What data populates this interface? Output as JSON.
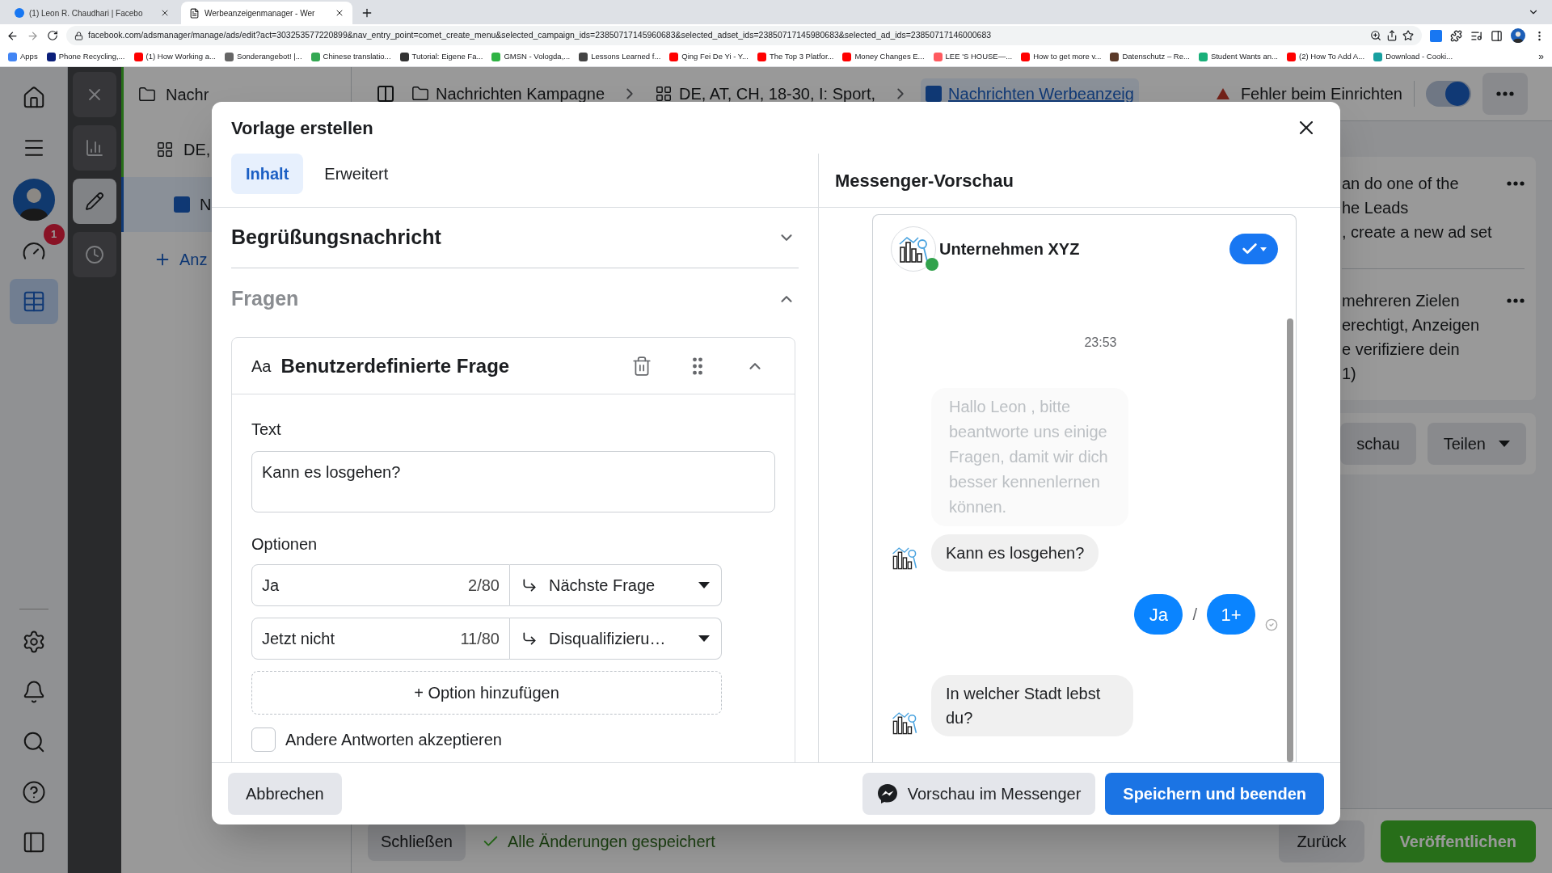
{
  "browser": {
    "tabs": [
      {
        "kind": "facebook",
        "title": "(1) Leon R. Chaudhari | Facebo",
        "selected": false
      },
      {
        "kind": "ads",
        "title": "Werbeanzeigenmanager - Wer",
        "selected": true
      }
    ],
    "url": "facebook.com/adsmanager/manage/ads/edit?act=303253577220899&nav_entry_point=comet_create_menu&selected_campaign_ids=23850717145960683&selected_adset_ids=23850717145980683&selected_ad_ids=23850717146000683",
    "bookmarks": [
      {
        "label": "Apps",
        "color": "#4285f4"
      },
      {
        "label": "Phone Recycling,...",
        "color": "#0b1f7a"
      },
      {
        "label": "(1) How Working a...",
        "color": "#ff0000"
      },
      {
        "label": "Sonderangebot! |...",
        "color": "#666666"
      },
      {
        "label": "Chinese translatio...",
        "color": "#34a853"
      },
      {
        "label": "Tutorial: Eigene Fa...",
        "color": "#333333"
      },
      {
        "label": "GMSN - Vologda,...",
        "color": "#2fb344"
      },
      {
        "label": "Lessons Learned f...",
        "color": "#444444"
      },
      {
        "label": "Qing Fei De Yi - Y...",
        "color": "#ff0000"
      },
      {
        "label": "The Top 3 Platfor...",
        "color": "#ff0000"
      },
      {
        "label": "Money Changes E...",
        "color": "#ff0000"
      },
      {
        "label": "LEE 'S HOUSE—...",
        "color": "#ff5a5f"
      },
      {
        "label": "How to get more v...",
        "color": "#ff0000"
      },
      {
        "label": "Datenschutz – Re...",
        "color": "#5b3a29"
      },
      {
        "label": "Student Wants an...",
        "color": "#1ab07a"
      },
      {
        "label": "(2) How To Add A...",
        "color": "#ff0000"
      },
      {
        "label": "Download - Cooki...",
        "color": "#18a0a0"
      }
    ],
    "more_bookmarks": "»"
  },
  "nav_rail": {
    "items": [
      {
        "kind": "home",
        "selected": false
      },
      {
        "kind": "menu",
        "selected": false
      },
      {
        "kind": "avatar"
      },
      {
        "kind": "gauge",
        "selected": false,
        "badge": "1"
      },
      {
        "kind": "table",
        "selected": true
      }
    ],
    "bottom_items": [
      {
        "kind": "settings",
        "selected": false
      },
      {
        "kind": "bell",
        "selected": false
      },
      {
        "kind": "search",
        "selected": false
      },
      {
        "kind": "help",
        "selected": false
      },
      {
        "kind": "panel",
        "selected": false
      }
    ]
  },
  "tool_column": {
    "items": [
      {
        "kind": "close",
        "selected": false
      },
      {
        "kind": "chart",
        "selected": false
      },
      {
        "kind": "edit",
        "selected": true
      },
      {
        "kind": "history",
        "selected": false
      }
    ]
  },
  "tree": {
    "items": [
      {
        "kind": "campaign",
        "label": "Nachr",
        "selected": false
      },
      {
        "kind": "adset",
        "label": "DE,",
        "selected": false
      },
      {
        "kind": "ad",
        "label": "N",
        "selected": true
      }
    ],
    "add_label": "Anz"
  },
  "top_bar": {
    "breadcrumbs": [
      {
        "kind": "campaign",
        "label": "Nachrichten Kampagne",
        "selected": false
      },
      {
        "kind": "adset",
        "label": "DE, AT, CH, 18-30, I: Sport,",
        "selected": false
      },
      {
        "kind": "ad",
        "label": "Nachrichten Werbeanzeig",
        "selected": true
      }
    ],
    "status": "Fehler beim Einrichten",
    "toggle_on": true
  },
  "side_panel": {
    "notices": [
      {
        "lines": [
          "an do one of the",
          "he Leads",
          ", create a new ad set"
        ]
      },
      {
        "lines": [
          "mehreren Zielen",
          "erechtigt, Anzeigen",
          "e verifiziere dein",
          "1)"
        ]
      }
    ],
    "buttons": [
      "schau",
      "Teilen"
    ]
  },
  "bottom_bar": {
    "close": "Schließen",
    "saved": "Alle Änderungen gespeichert",
    "back": "Zurück",
    "publish": "Veröffentlichen"
  },
  "modal": {
    "title": "Vorlage erstellen",
    "tabs": [
      {
        "label": "Inhalt",
        "selected": true
      },
      {
        "label": "Erweitert",
        "selected": false
      }
    ],
    "sections": [
      {
        "title": "Begrüßungsnachricht",
        "expanded": false
      },
      {
        "title": "Fragen",
        "expanded": true
      }
    ],
    "question": {
      "type_icon": "Aa",
      "title": "Benutzerdefinierte Frage",
      "text_label": "Text",
      "text_value": "Kann es losgehen?",
      "options_label": "Optionen",
      "options": [
        {
          "value": "Ja",
          "count": "2/80",
          "action": "Nächste Frage"
        },
        {
          "value": "Jetzt nicht",
          "count": "11/80",
          "action": "Disqualifizieru…"
        }
      ],
      "add_option": "+ Option hinzufügen",
      "accept_other": {
        "label": "Andere Antworten akzeptieren",
        "checked": false
      }
    },
    "footer": {
      "cancel": "Abbrechen",
      "preview": "Vorschau im Messenger",
      "save": "Speichern und beenden"
    },
    "preview": {
      "title": "Messenger-Vorschau",
      "page_name": "Unternehmen XYZ",
      "online": true,
      "time": "23:53",
      "messages": [
        {
          "kind": "greeting",
          "text": "Hallo Leon , bitte beantworte uns einige Fragen, damit wir dich besser kennenlernen können."
        },
        {
          "kind": "question",
          "text": "Kann es losgehen?"
        },
        {
          "kind": "replies",
          "options": [
            "Ja",
            "1+"
          ],
          "separator": "/"
        },
        {
          "kind": "question",
          "text": "In welcher Stadt lebst du?"
        }
      ]
    }
  }
}
